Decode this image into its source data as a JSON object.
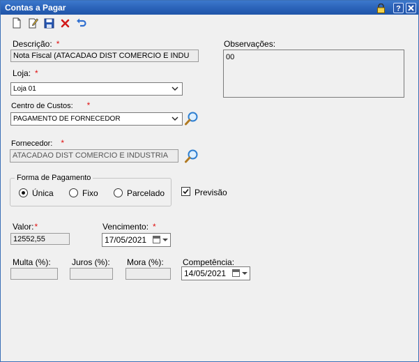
{
  "window": {
    "title": "Contas a Pagar"
  },
  "form": {
    "descricao": {
      "label": "Descrição:",
      "required": "*",
      "value": "Nota Fiscal (ATACADAO DIST COMERCIO E INDU"
    },
    "observacoes": {
      "label": "Observações:",
      "value": "00"
    },
    "loja": {
      "label": "Loja:",
      "required": "*",
      "value": "Loja 01"
    },
    "centro_custos": {
      "label": "Centro de Custos:",
      "required": "*",
      "value": "PAGAMENTO DE FORNECEDOR"
    },
    "fornecedor": {
      "label": "Fornecedor:",
      "required": "*",
      "value": "ATACADAO DIST COMERCIO E INDUSTRIA"
    },
    "forma_pagamento": {
      "label": "Forma de Pagamento",
      "options": [
        {
          "label": "Única",
          "selected": true
        },
        {
          "label": "Fixo",
          "selected": false
        },
        {
          "label": "Parcelado",
          "selected": false
        }
      ]
    },
    "previsao": {
      "label": "Previsão",
      "checked": true
    },
    "valor": {
      "label": "Valor:",
      "required": "*",
      "value": "12552,55"
    },
    "vencimento": {
      "label": "Vencimento:",
      "required": "*",
      "value": "17/05/2021"
    },
    "multa": {
      "label": "Multa (%):",
      "value": ""
    },
    "juros": {
      "label": "Juros (%):",
      "value": ""
    },
    "mora": {
      "label": "Mora (%):",
      "value": ""
    },
    "competencia": {
      "label": "Competência:",
      "value": "14/05/2021"
    }
  },
  "colors": {
    "titlebar": "#2a62b8",
    "required": "#e01010"
  }
}
